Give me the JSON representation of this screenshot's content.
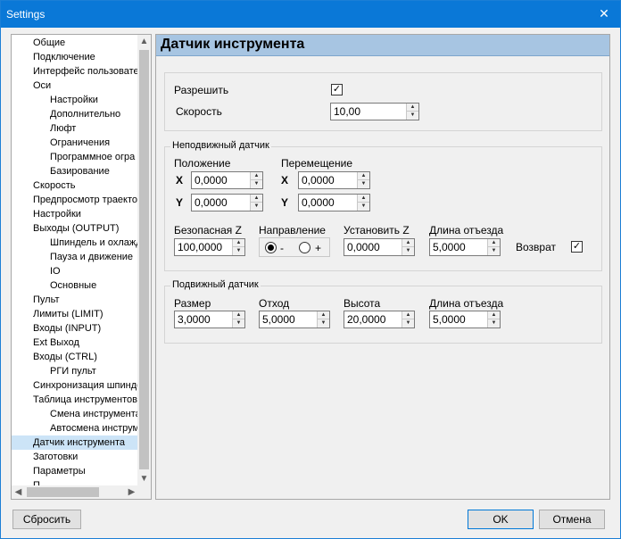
{
  "window": {
    "title": "Settings",
    "close_glyph": "✕"
  },
  "tree": {
    "items": [
      {
        "label": "Общие",
        "level": 0
      },
      {
        "label": "Подключение",
        "level": 0
      },
      {
        "label": "Интерфейс пользовате",
        "level": 0
      },
      {
        "label": "Оси",
        "level": 0
      },
      {
        "label": "Настройки",
        "level": 1
      },
      {
        "label": "Дополнительно",
        "level": 1
      },
      {
        "label": "Люфт",
        "level": 1
      },
      {
        "label": "Ограничения",
        "level": 1
      },
      {
        "label": "Программное огра",
        "level": 1
      },
      {
        "label": "Базирование",
        "level": 1
      },
      {
        "label": "Скорость",
        "level": 0
      },
      {
        "label": "Предпросмотр траекто",
        "level": 0
      },
      {
        "label": "Настройки",
        "level": 0
      },
      {
        "label": "Выходы (OUTPUT)",
        "level": 0
      },
      {
        "label": "Шпиндель и охлажд",
        "level": 1
      },
      {
        "label": "Пауза и движение",
        "level": 1
      },
      {
        "label": "IO",
        "level": 1
      },
      {
        "label": "Основные",
        "level": 1
      },
      {
        "label": "Пульт",
        "level": 0
      },
      {
        "label": "Лимиты (LIMIT)",
        "level": 0
      },
      {
        "label": "Входы (INPUT)",
        "level": 0
      },
      {
        "label": "Ext Выход",
        "level": 0
      },
      {
        "label": "Входы (CTRL)",
        "level": 0
      },
      {
        "label": "РГИ пульт",
        "level": 1
      },
      {
        "label": "Синхронизация шпинде",
        "level": 0
      },
      {
        "label": "Таблица инструментов",
        "level": 0
      },
      {
        "label": "Смена инструмента",
        "level": 1
      },
      {
        "label": "Автосмена инструм",
        "level": 1
      },
      {
        "label": "Датчик инструмента",
        "level": 0,
        "selected": true
      },
      {
        "label": "Заготовки",
        "level": 0
      },
      {
        "label": "Параметры",
        "level": 0
      },
      {
        "label": "П",
        "level": 0
      }
    ]
  },
  "panel": {
    "title": "Датчик инструмента",
    "general": {
      "enable_label": "Разрешить",
      "enable_checked": true,
      "speed_label": "Скорость",
      "speed_value": "10,00"
    },
    "fixed": {
      "title": "Неподвижный датчик",
      "position_label": "Положение",
      "move_label": "Перемещение",
      "x_label": "X",
      "y_label": "Y",
      "pos_x": "0,0000",
      "pos_y": "0,0000",
      "move_x": "0,0000",
      "move_y": "0,0000",
      "safe_z_label": "Безопасная Z",
      "safe_z": "100,0000",
      "direction_label": "Направление",
      "dir_minus": "-",
      "dir_plus": "+",
      "dir_selected": "-",
      "set_z_label": "Установить Z",
      "set_z": "0,0000",
      "retract_label": "Длина отъезда",
      "retract": "5,0000",
      "return_label": "Возврат",
      "return_checked": true
    },
    "mobile": {
      "title": "Подвижный датчик",
      "size_label": "Размер",
      "size": "3,0000",
      "offset_label": "Отход",
      "offset": "5,0000",
      "height_label": "Высота",
      "height": "20,0000",
      "retract_label": "Длина отъезда",
      "retract": "5,0000"
    }
  },
  "buttons": {
    "reset": "Сбросить",
    "ok": "OK",
    "cancel": "Отмена"
  },
  "check_glyph": "✓"
}
